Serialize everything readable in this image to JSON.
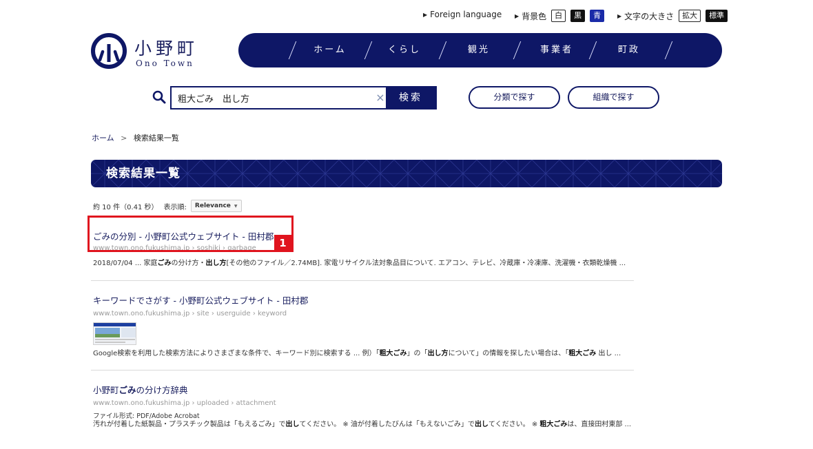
{
  "utility": {
    "foreign": "Foreign language",
    "bg_label": "背景色",
    "bg_white": "白",
    "bg_black": "黒",
    "bg_blue": "青",
    "font_label": "文字の大きさ",
    "font_large": "拡大",
    "font_normal": "標準"
  },
  "logo": {
    "jp": "小野町",
    "en": "Ono Town"
  },
  "nav": [
    "ホーム",
    "くらし",
    "観光",
    "事業者",
    "町政"
  ],
  "search": {
    "value": "粗大ごみ　出し方",
    "clear": "×",
    "button": "検索",
    "category_button": "分類で探す",
    "org_button": "組織で探す"
  },
  "breadcrumb": {
    "home": "ホーム",
    "sep": ">",
    "current": "検索結果一覧"
  },
  "page_title": "検索結果一覧",
  "meta": {
    "count": "約 10 件（0.41 秒）",
    "sort_label": "表示順:",
    "sort_value": "Relevance"
  },
  "results": [
    {
      "title": "ごみの分別 - 小野町公式ウェブサイト - 田村郡",
      "url": "www.town.ono.fukushima.jp › soshiki › garbage",
      "snippet": [
        {
          "t": "2018/07/04 ... 家庭",
          "b": false
        },
        {
          "t": "ごみ",
          "b": true
        },
        {
          "t": "の分け方・",
          "b": false
        },
        {
          "t": "出し方",
          "b": true
        },
        {
          "t": "[その他のファイル／2.74MB]. 家電リサイクル法対象品目について. エアコン、テレビ、冷蔵庫・冷凍庫、洗濯機・衣類乾燥機 ...",
          "b": false
        }
      ]
    },
    {
      "title": "キーワードでさがす - 小野町公式ウェブサイト - 田村郡",
      "url": "www.town.ono.fukushima.jp › site › userguide › keyword",
      "snippet": [
        {
          "t": "Google検索を利用した検索方法によりさまざまな条件で、キーワード別に検索する ... 例）「",
          "b": false
        },
        {
          "t": "粗大ごみ",
          "b": true
        },
        {
          "t": "」の「",
          "b": false
        },
        {
          "t": "出し方",
          "b": true
        },
        {
          "t": "について」の情報を探したい場合は、「",
          "b": false
        },
        {
          "t": "粗大ごみ",
          "b": true
        },
        {
          "t": " 出し ...",
          "b": false
        }
      ]
    },
    {
      "title_parts": [
        {
          "t": "小野町",
          "b": false
        },
        {
          "t": "ごみ",
          "b": true
        },
        {
          "t": "の分け方辞典",
          "b": false
        }
      ],
      "url": "www.town.ono.fukushima.jp › uploaded › attachment",
      "filetype": "ファイル形式: PDF/Adobe Acrobat",
      "snippet": [
        {
          "t": "汚れが付着した紙製品・プラスチック製品は「もえるごみ」で",
          "b": false
        },
        {
          "t": "出し",
          "b": true
        },
        {
          "t": "てください。 ※ 油が付着したびんは「もえないごみ」で",
          "b": false
        },
        {
          "t": "出し",
          "b": true
        },
        {
          "t": "てください。 ※ ",
          "b": false
        },
        {
          "t": "粗大ごみ",
          "b": true
        },
        {
          "t": "は、直接田村東部 ...",
          "b": false
        }
      ]
    }
  ],
  "annotation": {
    "label": "1"
  },
  "colors": {
    "navy": "#0e1766",
    "text_navy": "#1b2060",
    "annotation_red": "#e0141e"
  }
}
